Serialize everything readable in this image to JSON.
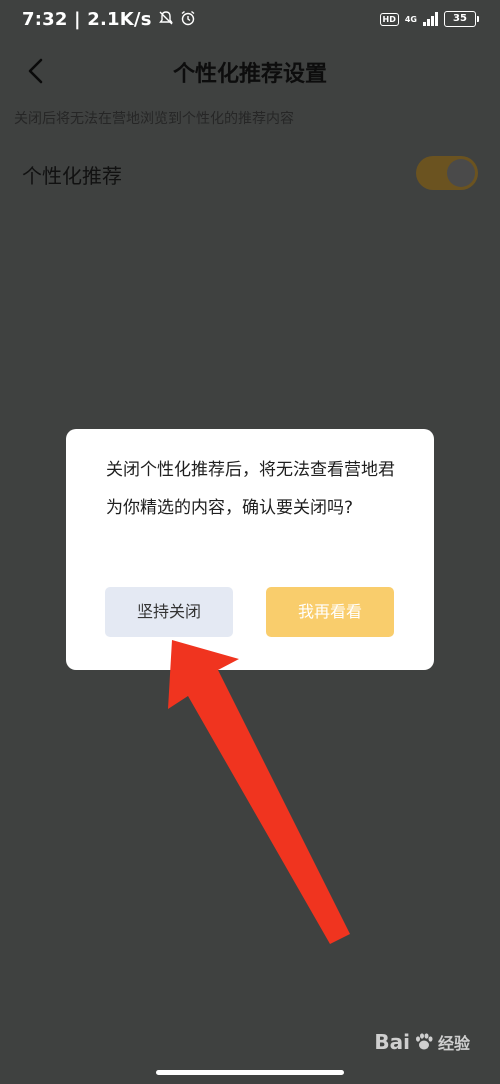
{
  "status_bar": {
    "time_speed": "7:32 | 2.1K/s",
    "hd": "HD",
    "network": "4G",
    "battery": "35"
  },
  "header": {
    "title": "个性化推荐设置"
  },
  "settings": {
    "description": "关闭后将无法在营地浏览到个性化的推荐内容",
    "personalized_label": "个性化推荐",
    "personalized_enabled": true
  },
  "dialog": {
    "message": "关闭个性化推荐后，将无法查看营地君为你精选的内容，确认要关闭吗?",
    "confirm_label": "坚持关闭",
    "cancel_label": "我再看看"
  },
  "watermark": {
    "brand": "Bai",
    "brand_suffix": "经验"
  },
  "colors": {
    "overlay_bg": "#3f4140",
    "dialog_bg": "#ffffff",
    "confirm_bg": "#e4e9f3",
    "cancel_bg": "#f9cd6c",
    "arrow": "#f0341f"
  }
}
